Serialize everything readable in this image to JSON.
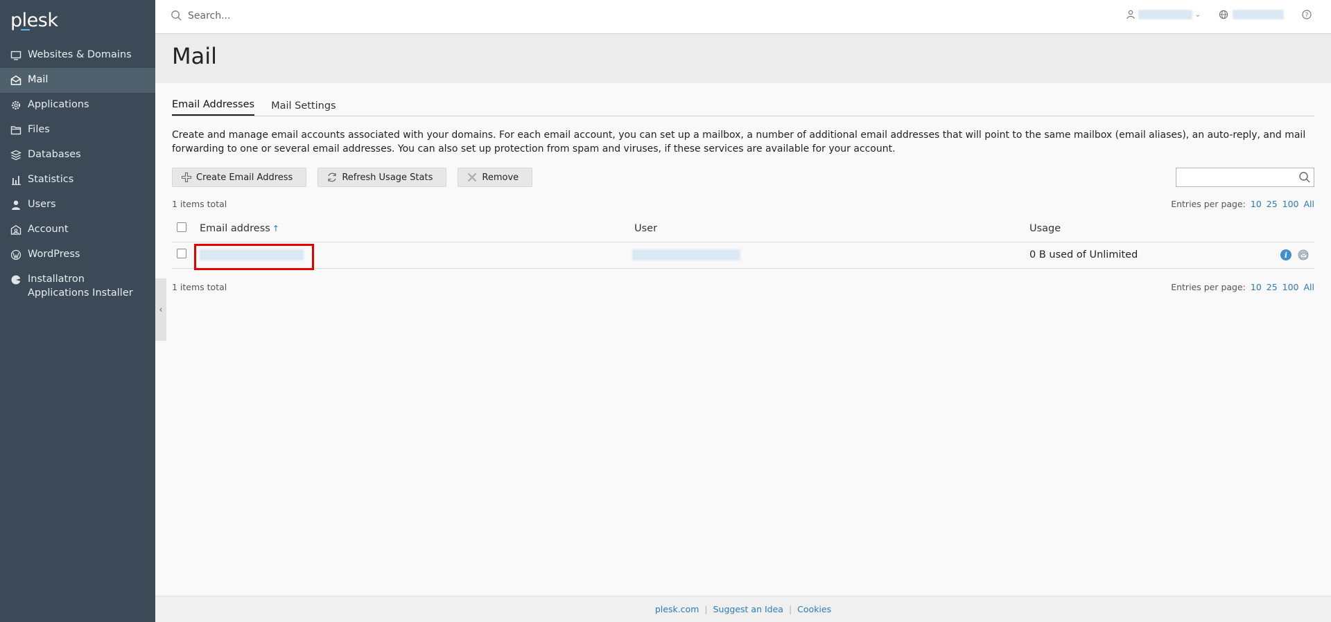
{
  "brand": {
    "logo_text": "plesk"
  },
  "sidebar": {
    "items": [
      {
        "label": "Websites & Domains",
        "icon": "monitor-icon"
      },
      {
        "label": "Mail",
        "icon": "mail-icon",
        "active": true
      },
      {
        "label": "Applications",
        "icon": "gear-icon"
      },
      {
        "label": "Files",
        "icon": "folder-icon"
      },
      {
        "label": "Databases",
        "icon": "database-icon"
      },
      {
        "label": "Statistics",
        "icon": "bar-chart-icon"
      },
      {
        "label": "Users",
        "icon": "user-icon"
      },
      {
        "label": "Account",
        "icon": "account-icon"
      },
      {
        "label": "WordPress",
        "icon": "wordpress-icon"
      },
      {
        "label": "Installatron Applications Installer",
        "icon": "installatron-icon"
      }
    ]
  },
  "topbar": {
    "search_placeholder": "Search..."
  },
  "page": {
    "title": "Mail"
  },
  "tabs": [
    {
      "label": "Email Addresses",
      "active": true
    },
    {
      "label": "Mail Settings",
      "active": false
    }
  ],
  "description": "Create and manage email accounts associated with your domains. For each email account, you can set up a mailbox, a number of additional email addresses that will point to the same mailbox (email aliases), an auto-reply, and mail forwarding to one or several email addresses. You can also set up protection from spam and viruses, if these services are available for your account.",
  "toolbar": {
    "create_label": "Create Email Address",
    "refresh_label": "Refresh Usage Stats",
    "remove_label": "Remove"
  },
  "list": {
    "total_text": "1 items total",
    "entries_label": "Entries per page:",
    "entries_options": [
      "10",
      "25",
      "100",
      "All"
    ],
    "columns": {
      "email": "Email address",
      "user": "User",
      "usage": "Usage"
    },
    "sort_arrow": "↑",
    "rows": [
      {
        "usage": "0 B used of Unlimited"
      }
    ]
  },
  "footer": {
    "links": [
      "plesk.com",
      "Suggest an Idea",
      "Cookies"
    ]
  },
  "colors": {
    "sidebar_bg": "#3b4a56",
    "sidebar_active": "#50616e",
    "link": "#2a7bbd",
    "highlight": "#e60000"
  }
}
